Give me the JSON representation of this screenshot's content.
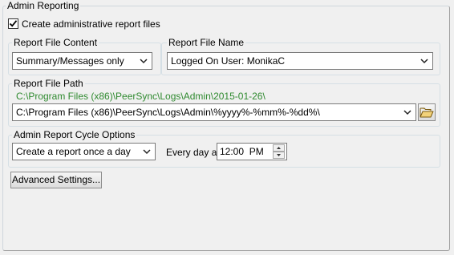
{
  "admin_reporting": {
    "title": "Admin Reporting",
    "create_files_label": "Create administrative report files",
    "create_files_checked": true
  },
  "report_content": {
    "title": "Report File Content",
    "selected": "Summary/Messages only"
  },
  "report_name": {
    "title": "Report File Name",
    "selected": "Logged On User: MonikaC"
  },
  "report_path": {
    "title": "Report File Path",
    "resolved": "C:\\Program Files (x86)\\PeerSync\\Logs\\Admin\\2015-01-26\\",
    "value": "C:\\Program Files (x86)\\PeerSync\\Logs\\Admin\\%yyyy%-%mm%-%dd%\\"
  },
  "cycle_options": {
    "title": "Admin Report Cycle Options",
    "selected": "Create a report once a day",
    "every_day_label": "Every day at",
    "time_value": "12:00  PM"
  },
  "advanced_button_label": "Advanced Settings...",
  "icons": {
    "chevron": "chevron-down-icon",
    "folder": "folder-open-icon",
    "check": "check-icon",
    "spin_up": "spin-up-icon",
    "spin_down": "spin-down-icon"
  }
}
